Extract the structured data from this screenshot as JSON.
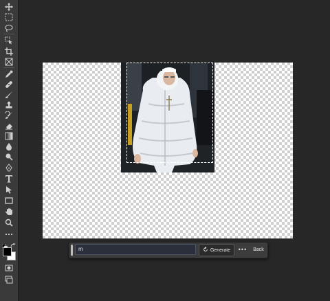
{
  "toolbar": {
    "tools": [
      "move-icon",
      "marquee-icon",
      "lasso-icon",
      "object-select-icon",
      "crop-icon",
      "frame-icon",
      "eyedropper-icon",
      "healing-brush-icon",
      "brush-icon",
      "clone-stamp-icon",
      "history-brush-icon",
      "eraser-icon",
      "gradient-icon",
      "blur-icon",
      "dodge-icon",
      "pen-icon",
      "type-icon",
      "path-select-icon",
      "rectangle-icon",
      "hand-icon",
      "zoom-icon",
      "more-tools-icon"
    ],
    "foreground_color": "#000000",
    "background_color": "#ffffff"
  },
  "contextual_taskbar": {
    "prompt_value": "m",
    "generate_label": "Generate",
    "more_label": "•••",
    "back_label": "Back"
  }
}
